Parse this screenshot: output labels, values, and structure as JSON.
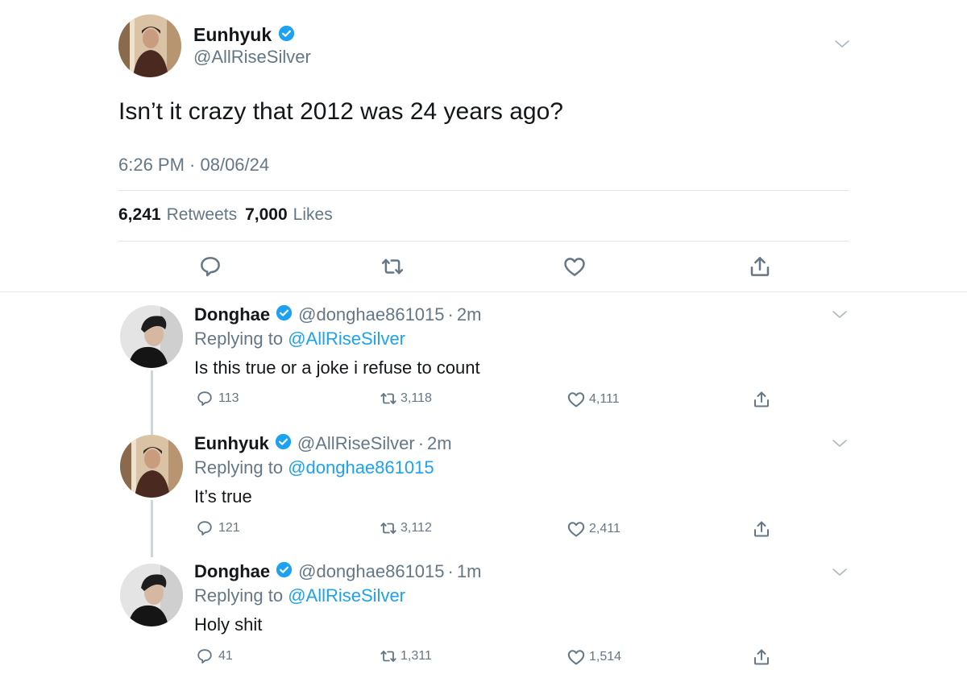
{
  "main": {
    "author": {
      "name": "Eunhyuk",
      "handle": "@AllRiseSilver"
    },
    "text": "Isn’t it crazy that 2012 was 24 years ago?",
    "timestamp": "6:26 PM · 08/06/24",
    "stats": {
      "retweets_count": "6,241",
      "retweets_label": "Retweets",
      "likes_count": "7,000",
      "likes_label": "Likes"
    },
    "actions": [
      "reply-icon",
      "retweet-icon",
      "like-icon",
      "share-icon"
    ]
  },
  "replies": [
    {
      "name": "Donghae",
      "handle": "@donghae861015",
      "separator": "·",
      "time": "2m",
      "replying_prefix": "Replying to",
      "replying_to": "@AllRiseSilver",
      "text": "Is this true or a joke i refuse to count",
      "reply_count": "113",
      "retweet_count": "3,118",
      "like_count": "4,111"
    },
    {
      "name": "Eunhyuk",
      "handle": "@AllRiseSilver",
      "separator": "·",
      "time": "2m",
      "replying_prefix": "Replying to",
      "replying_to": "@donghae861015",
      "text": "It’s true",
      "reply_count": "121",
      "retweet_count": "3,112",
      "like_count": "2,411"
    },
    {
      "name": "Donghae",
      "handle": "@donghae861015",
      "separator": "·",
      "time": "1m",
      "replying_prefix": "Replying to",
      "replying_to": "@AllRiseSilver",
      "text": "Holy shit",
      "reply_count": "41",
      "retweet_count": "1,311",
      "like_count": "1,514"
    }
  ],
  "colors": {
    "verified": "#1da1f2",
    "mention": "#1da1f2",
    "secondary_text": "#657786",
    "primary_text": "#14171a",
    "divider": "#e1e8ed",
    "thread_line": "#ccd6dd"
  }
}
